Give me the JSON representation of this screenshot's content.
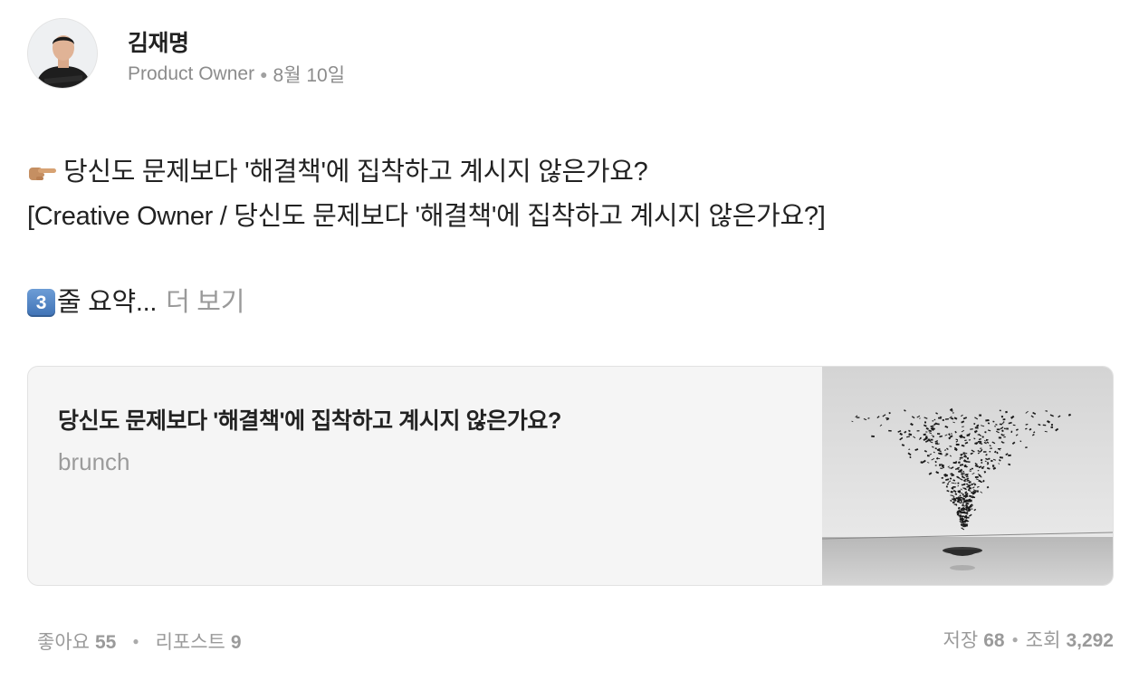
{
  "author": {
    "name": "김재명",
    "role": "Product Owner",
    "date": "8월 10일",
    "avatar_icon": "avatar-photo"
  },
  "post": {
    "line1_icon": "backhand-index-pointing-right",
    "line1": "당신도 문제보다 '해결책'에 집착하고 계시지 않은가요?",
    "line2": "[Creative Owner / 당신도 문제보다 '해결책'에 집착하고 계시지 않은가요?]",
    "line3_keycap": "3",
    "line3": "줄 요약...",
    "more_label": "더 보기"
  },
  "link_card": {
    "title": "당신도 문제보다 '해결책'에 집착하고 계시지 않은가요?",
    "source": "brunch",
    "image_icon": "art-installation-thumbnail"
  },
  "stats": {
    "likes_label": "좋아요",
    "likes": "55",
    "reposts_label": "리포스트",
    "reposts": "9",
    "saves_label": "저장",
    "saves": "68",
    "views_label": "조회",
    "views": "3,292"
  },
  "colors": {
    "text_primary": "#222222",
    "text_secondary": "#8c8c8c",
    "card_background": "#f5f5f5",
    "card_border": "#e2e2e2"
  }
}
